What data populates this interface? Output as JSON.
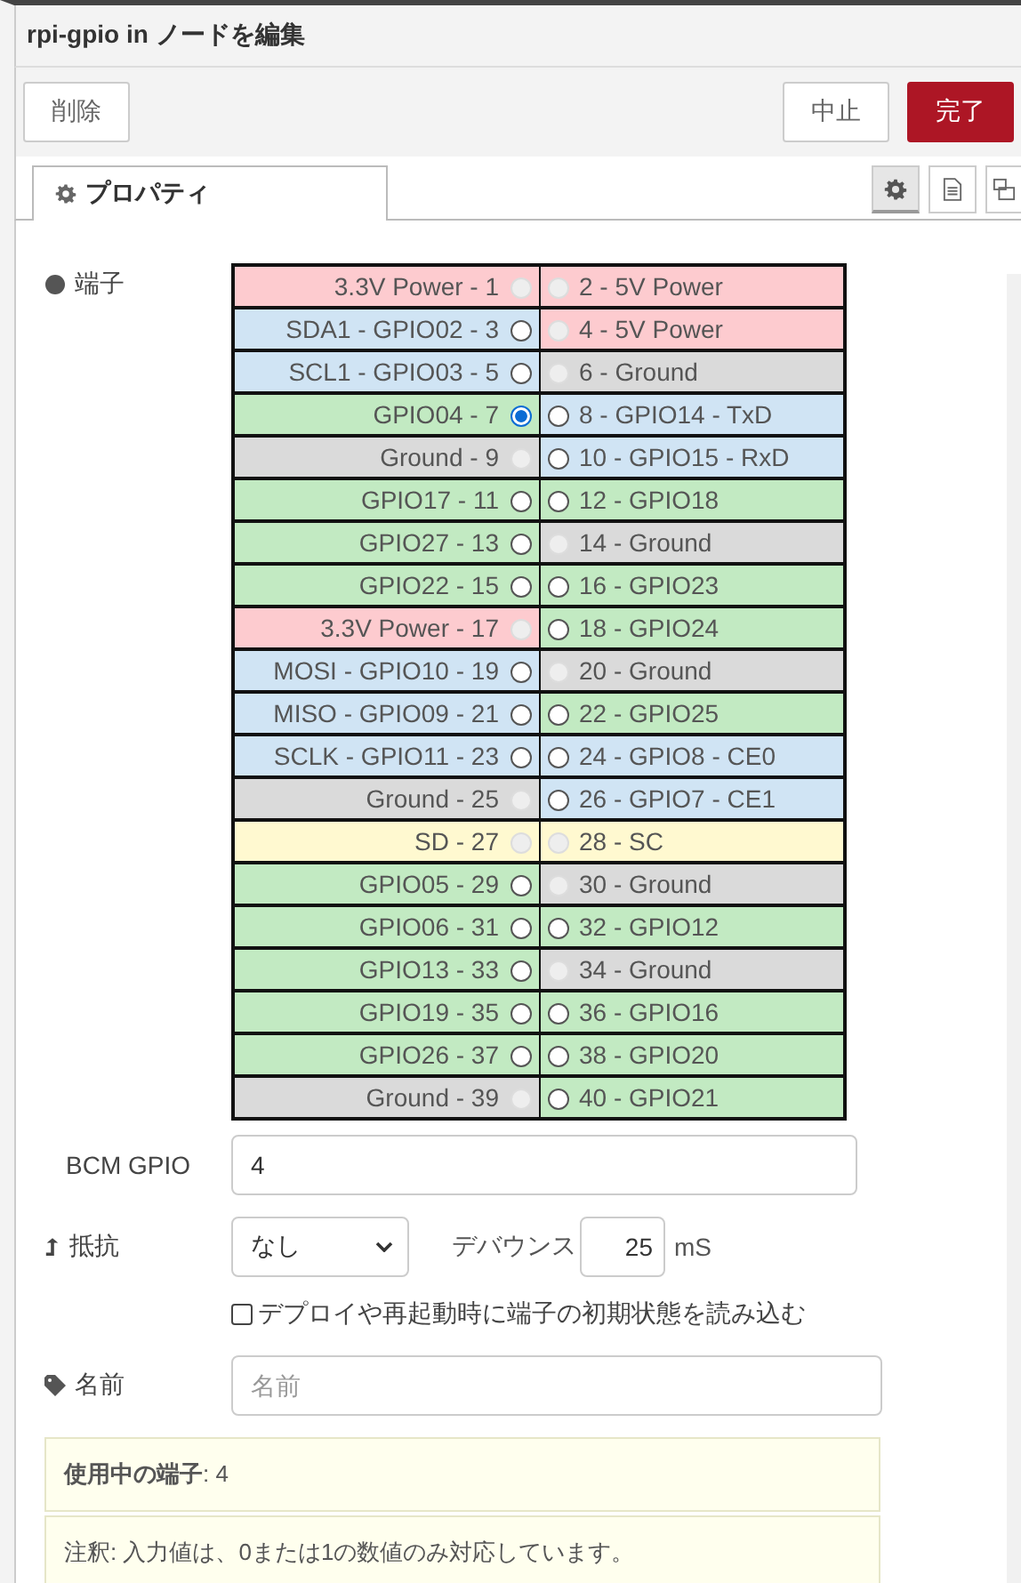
{
  "window": {
    "title": "rpi-gpio in ノードを編集"
  },
  "buttons": {
    "delete": "削除",
    "cancel": "中止",
    "done": "完了"
  },
  "tabs": [
    {
      "label": "プロパティ",
      "selected": true
    }
  ],
  "tab_tools": [
    {
      "kind": "gear",
      "selected": true
    },
    {
      "kind": "doc",
      "selected": false
    },
    {
      "kind": "frame",
      "selected": false
    }
  ],
  "pins_label": "端子",
  "pins": [
    {
      "left": {
        "label": "3.3V Power - 1",
        "color": "#fdcbcf",
        "selected": false,
        "disabled": true
      },
      "right": {
        "label": "2 - 5V Power",
        "color": "#fdcbcf",
        "selected": false,
        "disabled": true
      }
    },
    {
      "left": {
        "label": "SDA1 - GPIO02 - 3",
        "color": "#d0e4f4",
        "selected": false,
        "disabled": false
      },
      "right": {
        "label": "4 - 5V Power",
        "color": "#fdcbcf",
        "selected": false,
        "disabled": true
      }
    },
    {
      "left": {
        "label": "SCL1 - GPIO03 - 5",
        "color": "#d0e4f4",
        "selected": false,
        "disabled": false
      },
      "right": {
        "label": "6 - Ground",
        "color": "#dadada",
        "selected": false,
        "disabled": true
      }
    },
    {
      "left": {
        "label": "GPIO04 - 7",
        "color": "#c2eac2",
        "selected": true,
        "disabled": false
      },
      "right": {
        "label": "8 - GPIO14 - TxD",
        "color": "#d0e4f4",
        "selected": false,
        "disabled": false
      }
    },
    {
      "left": {
        "label": "Ground - 9",
        "color": "#dadada",
        "selected": false,
        "disabled": true
      },
      "right": {
        "label": "10 - GPIO15 - RxD",
        "color": "#d0e4f4",
        "selected": false,
        "disabled": false
      }
    },
    {
      "left": {
        "label": "GPIO17 - 11",
        "color": "#c2eac2",
        "selected": false,
        "disabled": false
      },
      "right": {
        "label": "12 - GPIO18",
        "color": "#c2eac2",
        "selected": false,
        "disabled": false
      }
    },
    {
      "left": {
        "label": "GPIO27 - 13",
        "color": "#c2eac2",
        "selected": false,
        "disabled": false
      },
      "right": {
        "label": "14 - Ground",
        "color": "#dadada",
        "selected": false,
        "disabled": true
      }
    },
    {
      "left": {
        "label": "GPIO22 - 15",
        "color": "#c2eac2",
        "selected": false,
        "disabled": false
      },
      "right": {
        "label": "16 - GPIO23",
        "color": "#c2eac2",
        "selected": false,
        "disabled": false
      }
    },
    {
      "left": {
        "label": "3.3V Power - 17",
        "color": "#fdcbcf",
        "selected": false,
        "disabled": true
      },
      "right": {
        "label": "18 - GPIO24",
        "color": "#c2eac2",
        "selected": false,
        "disabled": false
      }
    },
    {
      "left": {
        "label": "MOSI - GPIO10 - 19",
        "color": "#d0e4f4",
        "selected": false,
        "disabled": false
      },
      "right": {
        "label": "20 - Ground",
        "color": "#dadada",
        "selected": false,
        "disabled": true
      }
    },
    {
      "left": {
        "label": "MISO - GPIO09 - 21",
        "color": "#d0e4f4",
        "selected": false,
        "disabled": false
      },
      "right": {
        "label": "22 - GPIO25",
        "color": "#c2eac2",
        "selected": false,
        "disabled": false
      }
    },
    {
      "left": {
        "label": "SCLK - GPIO11 - 23",
        "color": "#d0e4f4",
        "selected": false,
        "disabled": false
      },
      "right": {
        "label": "24 - GPIO8 - CE0",
        "color": "#d0e4f4",
        "selected": false,
        "disabled": false
      }
    },
    {
      "left": {
        "label": "Ground - 25",
        "color": "#dadada",
        "selected": false,
        "disabled": true
      },
      "right": {
        "label": "26 - GPIO7 - CE1",
        "color": "#d0e4f4",
        "selected": false,
        "disabled": false
      }
    },
    {
      "left": {
        "label": "SD - 27",
        "color": "#fff9d0",
        "selected": false,
        "disabled": true
      },
      "right": {
        "label": "28 - SC",
        "color": "#fff9d0",
        "selected": false,
        "disabled": true
      }
    },
    {
      "left": {
        "label": "GPIO05 - 29",
        "color": "#c2eac2",
        "selected": false,
        "disabled": false
      },
      "right": {
        "label": "30 - Ground",
        "color": "#dadada",
        "selected": false,
        "disabled": true
      }
    },
    {
      "left": {
        "label": "GPIO06 - 31",
        "color": "#c2eac2",
        "selected": false,
        "disabled": false
      },
      "right": {
        "label": "32 - GPIO12",
        "color": "#c2eac2",
        "selected": false,
        "disabled": false
      }
    },
    {
      "left": {
        "label": "GPIO13 - 33",
        "color": "#c2eac2",
        "selected": false,
        "disabled": false
      },
      "right": {
        "label": "34 - Ground",
        "color": "#dadada",
        "selected": false,
        "disabled": true
      }
    },
    {
      "left": {
        "label": "GPIO19 - 35",
        "color": "#c2eac2",
        "selected": false,
        "disabled": false
      },
      "right": {
        "label": "36 - GPIO16",
        "color": "#c2eac2",
        "selected": false,
        "disabled": false
      }
    },
    {
      "left": {
        "label": "GPIO26 - 37",
        "color": "#c2eac2",
        "selected": false,
        "disabled": false
      },
      "right": {
        "label": "38 - GPIO20",
        "color": "#c2eac2",
        "selected": false,
        "disabled": false
      }
    },
    {
      "left": {
        "label": "Ground - 39",
        "color": "#dadada",
        "selected": false,
        "disabled": true
      },
      "right": {
        "label": "40 - GPIO21",
        "color": "#c2eac2",
        "selected": false,
        "disabled": false
      }
    }
  ],
  "bcm": {
    "label": "BCM GPIO",
    "value": "4"
  },
  "resistor": {
    "label": "抵抗",
    "value": "なし"
  },
  "debounce": {
    "label": "デバウンス",
    "value": "25",
    "unit": "mS"
  },
  "read_initial": {
    "label": "デプロイや再起動時に端子の初期状態を読み込む",
    "checked": false
  },
  "name": {
    "label": "名前",
    "placeholder": "名前"
  },
  "notes": [
    "**使用中の端子**: 4",
    "注釈: 入力値は、0または1の数値のみ対応しています。"
  ]
}
